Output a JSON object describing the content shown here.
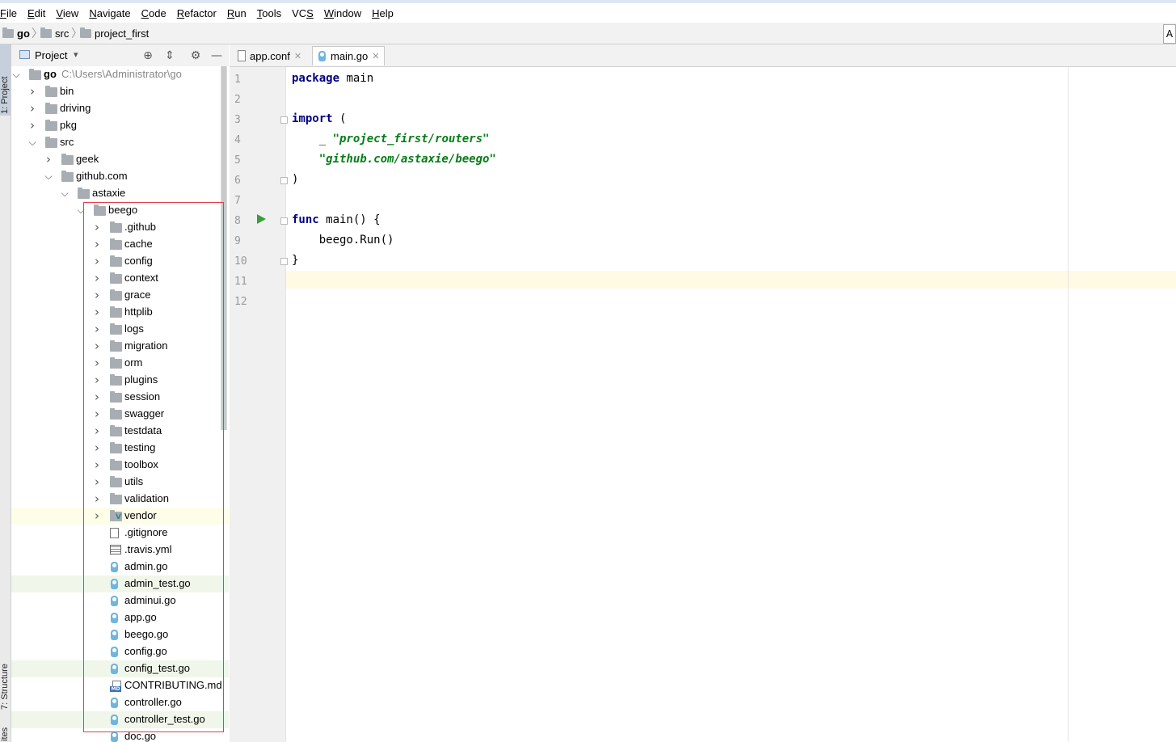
{
  "menu": [
    "File",
    "Edit",
    "View",
    "Navigate",
    "Code",
    "Refactor",
    "Run",
    "Tools",
    "VCS",
    "Window",
    "Help"
  ],
  "breadcrumb": [
    "go",
    "src",
    "project_first"
  ],
  "nav_right_label": "A",
  "left_strip": {
    "project_tab": "1: Project",
    "structure_tab": "7: Structure",
    "favorites_tab": "ites"
  },
  "project_panel": {
    "title": "Project",
    "view_options": "▾"
  },
  "tree": [
    {
      "label": "go",
      "path": "C:\\Users\\Administrator\\go",
      "kind": "folder",
      "level": 0,
      "expanded": true,
      "bold": true
    },
    {
      "label": "bin",
      "kind": "folder",
      "level": 1,
      "expanded": false
    },
    {
      "label": "driving",
      "kind": "folder",
      "level": 1,
      "expanded": false
    },
    {
      "label": "pkg",
      "kind": "folder",
      "level": 1,
      "expanded": false
    },
    {
      "label": "src",
      "kind": "folder",
      "level": 1,
      "expanded": true
    },
    {
      "label": "geek",
      "kind": "folder",
      "level": 2,
      "expanded": false
    },
    {
      "label": "github.com",
      "kind": "folder",
      "level": 2,
      "expanded": true
    },
    {
      "label": "astaxie",
      "kind": "folder",
      "level": 3,
      "expanded": true
    },
    {
      "label": "beego",
      "kind": "folder",
      "level": 4,
      "expanded": true
    },
    {
      "label": ".github",
      "kind": "folder",
      "level": 5,
      "expanded": false
    },
    {
      "label": "cache",
      "kind": "folder",
      "level": 5,
      "expanded": false
    },
    {
      "label": "config",
      "kind": "folder",
      "level": 5,
      "expanded": false
    },
    {
      "label": "context",
      "kind": "folder",
      "level": 5,
      "expanded": false
    },
    {
      "label": "grace",
      "kind": "folder",
      "level": 5,
      "expanded": false
    },
    {
      "label": "httplib",
      "kind": "folder",
      "level": 5,
      "expanded": false
    },
    {
      "label": "logs",
      "kind": "folder",
      "level": 5,
      "expanded": false
    },
    {
      "label": "migration",
      "kind": "folder",
      "level": 5,
      "expanded": false
    },
    {
      "label": "orm",
      "kind": "folder",
      "level": 5,
      "expanded": false
    },
    {
      "label": "plugins",
      "kind": "folder",
      "level": 5,
      "expanded": false
    },
    {
      "label": "session",
      "kind": "folder",
      "level": 5,
      "expanded": false
    },
    {
      "label": "swagger",
      "kind": "folder",
      "level": 5,
      "expanded": false
    },
    {
      "label": "testdata",
      "kind": "folder",
      "level": 5,
      "expanded": false
    },
    {
      "label": "testing",
      "kind": "folder",
      "level": 5,
      "expanded": false
    },
    {
      "label": "toolbox",
      "kind": "folder",
      "level": 5,
      "expanded": false
    },
    {
      "label": "utils",
      "kind": "folder",
      "level": 5,
      "expanded": false
    },
    {
      "label": "validation",
      "kind": "folder",
      "level": 5,
      "expanded": false
    },
    {
      "label": "vendor",
      "kind": "folder",
      "level": 5,
      "expanded": false,
      "highlight": "yellow"
    },
    {
      "label": ".gitignore",
      "kind": "text",
      "level": 5
    },
    {
      "label": ".travis.yml",
      "kind": "yml",
      "level": 5
    },
    {
      "label": "admin.go",
      "kind": "go",
      "level": 5
    },
    {
      "label": "admin_test.go",
      "kind": "go",
      "level": 5,
      "highlight": "green"
    },
    {
      "label": "adminui.go",
      "kind": "go",
      "level": 5
    },
    {
      "label": "app.go",
      "kind": "go",
      "level": 5
    },
    {
      "label": "beego.go",
      "kind": "go",
      "level": 5
    },
    {
      "label": "config.go",
      "kind": "go",
      "level": 5
    },
    {
      "label": "config_test.go",
      "kind": "go",
      "level": 5,
      "highlight": "green"
    },
    {
      "label": "CONTRIBUTING.md",
      "kind": "md",
      "level": 5
    },
    {
      "label": "controller.go",
      "kind": "go",
      "level": 5
    },
    {
      "label": "controller_test.go",
      "kind": "go",
      "level": 5,
      "highlight": "green"
    },
    {
      "label": "doc.go",
      "kind": "go",
      "level": 5
    }
  ],
  "tabs": [
    {
      "label": "app.conf",
      "active": false
    },
    {
      "label": "main.go",
      "active": true
    }
  ],
  "line_numbers": [
    "1",
    "2",
    "3",
    "4",
    "5",
    "6",
    "7",
    "8",
    "9",
    "10",
    "11",
    "12"
  ],
  "code_lines": [
    [
      {
        "t": "package",
        "c": "kw"
      },
      {
        "t": " main",
        "c": ""
      }
    ],
    [],
    [
      {
        "t": "import",
        "c": "kw"
      },
      {
        "t": " (",
        "c": ""
      }
    ],
    [
      {
        "t": "    _ ",
        "c": ""
      },
      {
        "t": "\"project_first/routers\"",
        "c": "str"
      }
    ],
    [
      {
        "t": "    ",
        "c": ""
      },
      {
        "t": "\"github.com/astaxie/beego\"",
        "c": "str"
      }
    ],
    [
      {
        "t": ")",
        "c": ""
      }
    ],
    [],
    [
      {
        "t": "func",
        "c": "kw"
      },
      {
        "t": " main() {",
        "c": ""
      }
    ],
    [
      {
        "t": "    beego.Run()",
        "c": ""
      }
    ],
    [
      {
        "t": "}",
        "c": ""
      }
    ],
    [],
    []
  ],
  "colors": {
    "keyword": "#000080",
    "string": "#067d17",
    "caret_line": "#fffae3",
    "highlight_box": "#e0404a"
  }
}
